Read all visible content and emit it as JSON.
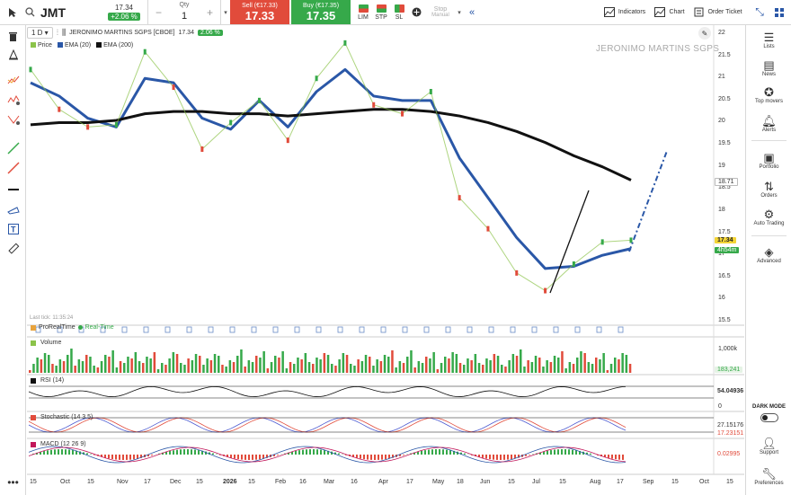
{
  "header": {
    "symbol": "JMT",
    "last_price": "17.34",
    "change_pct": "+2.06 %",
    "qty_label": "Qty",
    "qty_value": "1",
    "sell_label": "Sell (€17.33)",
    "sell_price": "17.33",
    "buy_label": "Buy (€17.35)",
    "buy_price": "17.35",
    "order_types": [
      "LIM",
      "STP",
      "SL"
    ],
    "stop_label": "Stop",
    "stop_sub": "Manual",
    "indicators_label": "Indicators",
    "chart_label": "Chart",
    "order_ticket_label": "Order Ticket"
  },
  "chart_header": {
    "timeframe": "1 D",
    "instrument": "JERONIMO MARTINS SGPS [CBOE]",
    "price": "17.34",
    "change": "2.06 %",
    "watermark": "JERONIMO MARTINS SGPS",
    "last_tick": "Last tick: 11:35:24",
    "prorealtime": "ProRealTime",
    "realtime": "Real-Time"
  },
  "legend": [
    {
      "label": "Price",
      "color": "#8bc34a"
    },
    {
      "label": "EMA (20)",
      "color": "#2a57a7"
    },
    {
      "label": "EMA (200)",
      "color": "#111111"
    }
  ],
  "price_axis": [
    "22",
    "21.5",
    "21",
    "20.5",
    "20",
    "19.5",
    "19",
    "18.5",
    "18",
    "17.5",
    "17",
    "16.5",
    "16",
    "15.5"
  ],
  "tags": {
    "level": "18.71",
    "price": "17.34",
    "countdown": "4h54m"
  },
  "panes": {
    "volume": {
      "title": "Volume",
      "axis": "1,000k",
      "value": "183,241"
    },
    "rsi": {
      "title": "RSI (14)",
      "value": "54.04936",
      "zero": "0"
    },
    "stochastic": {
      "title": "Stochastic (14 3 5)",
      "value1": "27.15176",
      "value2": "17.23151"
    },
    "macd": {
      "title": "MACD (12 26 9)",
      "value": "0.02995"
    }
  },
  "x_axis": [
    "15",
    "Oct",
    "15",
    "Nov",
    "17",
    "Dec",
    "15",
    "2026",
    "15",
    "Feb",
    "16",
    "Mar",
    "16",
    "Apr",
    "17",
    "May",
    "18",
    "Jun",
    "15",
    "Jul",
    "15",
    "Aug",
    "17",
    "Sep",
    "15",
    "Oct",
    "15"
  ],
  "sidebar": [
    {
      "label": "Lists",
      "icon": "list-icon"
    },
    {
      "label": "News",
      "icon": "news-icon"
    },
    {
      "label": "Top movers",
      "icon": "medal-icon"
    },
    {
      "label": "Alerts",
      "icon": "bell-icon"
    },
    {
      "label": "Portfolio",
      "icon": "portfolio-icon"
    },
    {
      "label": "Orders",
      "icon": "orders-icon"
    },
    {
      "label": "Auto Trading",
      "icon": "gears-icon"
    },
    {
      "label": "Advanced",
      "icon": "layers-icon"
    },
    {
      "label": "Support",
      "icon": "user-icon"
    },
    {
      "label": "Preferences",
      "icon": "wrench-icon"
    }
  ],
  "dark_mode_label": "DARK MODE",
  "colors": {
    "up": "#36a94a",
    "down": "#e14b3b",
    "ema20": "#2a57a7",
    "ema200": "#111111",
    "accent": "#2a57a7"
  },
  "chart_data": {
    "type": "line",
    "ylim": [
      15.5,
      22
    ],
    "x": [
      "15",
      "Oct",
      "15",
      "Nov",
      "17",
      "Dec",
      "15",
      "2026",
      "15",
      "Feb",
      "16",
      "Mar",
      "16",
      "Apr",
      "17",
      "May",
      "18",
      "Jun",
      "15",
      "Jul",
      "15",
      "Aug",
      "17",
      "Sep",
      "15",
      "Oct",
      "15"
    ],
    "series": [
      {
        "name": "EMA (20)",
        "values": [
          20.9,
          20.6,
          20.1,
          19.9,
          21.0,
          20.9,
          20.1,
          19.85,
          20.5,
          19.9,
          20.7,
          21.2,
          20.6,
          20.5,
          20.5,
          19.2,
          18.3,
          17.4,
          16.7,
          16.75,
          17.0,
          17.15
        ]
      },
      {
        "name": "EMA (200)",
        "values": [
          19.95,
          20.0,
          20.0,
          20.05,
          20.2,
          20.25,
          20.25,
          20.2,
          20.2,
          20.15,
          20.2,
          20.25,
          20.3,
          20.3,
          20.25,
          20.15,
          20.0,
          19.8,
          19.55,
          19.25,
          19.0,
          18.7
        ]
      },
      {
        "name": "Price",
        "values": [
          21.2,
          20.3,
          19.9,
          19.95,
          21.6,
          20.8,
          19.4,
          20.0,
          20.5,
          19.6,
          21.0,
          21.8,
          20.4,
          20.2,
          20.7,
          18.3,
          17.6,
          16.6,
          16.2,
          16.8,
          17.3,
          17.34
        ]
      }
    ]
  }
}
